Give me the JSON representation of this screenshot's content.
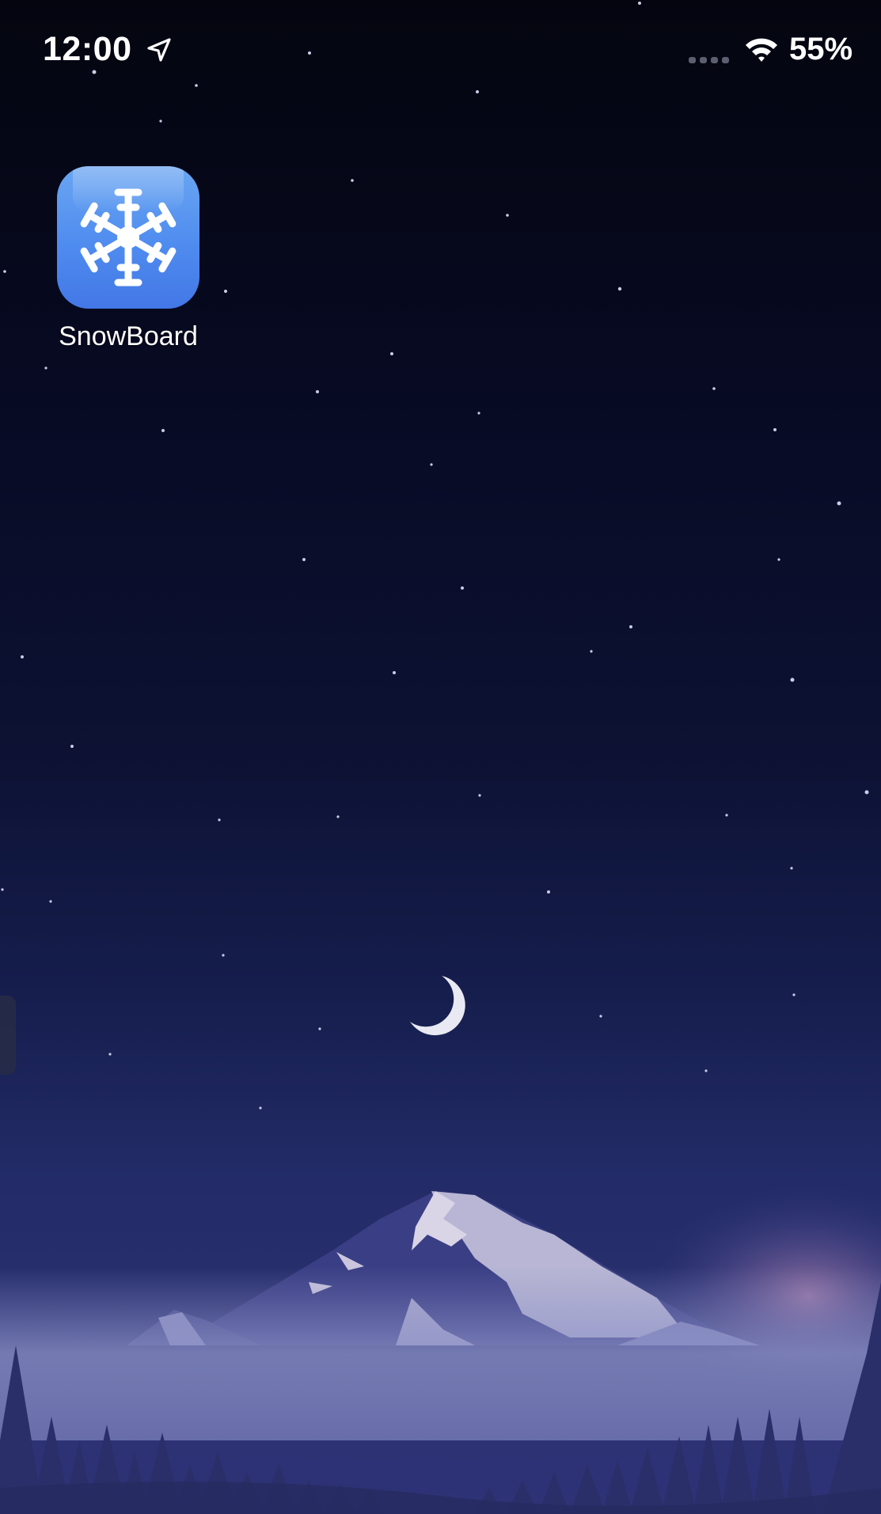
{
  "status_bar": {
    "time": "12:00",
    "battery": "55%",
    "icons": [
      "location-arrow-icon",
      "cellular-signal-icon",
      "wifi-icon"
    ]
  },
  "home_screen": {
    "apps": [
      {
        "label": "SnowBoard",
        "icon": "snowflake-icon",
        "color": "#4f8cef"
      }
    ]
  },
  "wallpaper": {
    "description_icons": [
      "moon-icon",
      "mountain",
      "trees"
    ],
    "sky_color": "#0b1030"
  }
}
